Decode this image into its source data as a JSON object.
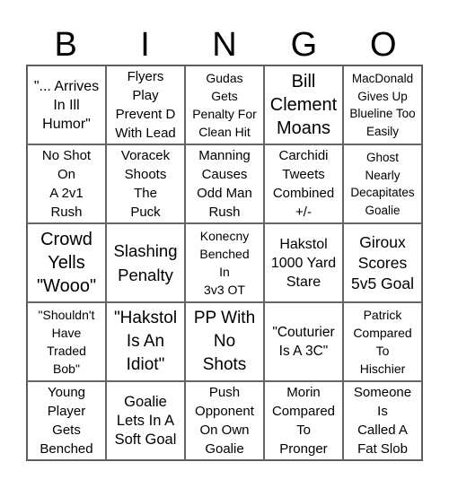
{
  "header": {
    "letters": [
      "B",
      "I",
      "N",
      "G",
      "O"
    ]
  },
  "cells": [
    [
      "\"... Arrives\nIn Ill\nHumor\"",
      "Flyers\nPlay\nPrevent D\nWith Lead",
      "Gudas\nGets\nPenalty For\nClean Hit",
      "Bill\nClement\nMoans",
      "MacDonald\nGives Up\nBlueline Too\nEasily"
    ],
    [
      "No Shot\nOn\nA 2v1\nRush",
      "Voracek\nShoots\nThe\nPuck",
      "Manning\nCauses\nOdd Man\nRush",
      "Carchidi\nTweets\nCombined\n+/-",
      "Ghost\nNearly\nDecapitates\nGoalie"
    ],
    [
      "Crowd\nYells\n\"Wooo\"",
      "Slashing\nPenalty",
      "Konecny\nBenched\nIn\n3v3 OT",
      "Hakstol\n1000 Yard\nStare",
      "Giroux\nScores\n5v5 Goal"
    ],
    [
      "\"Shouldn't\nHave\nTraded\nBob\"",
      "\"Hakstol\nIs An\nIdiot\"",
      "PP With\nNo\nShots",
      "\"Couturier\nIs A 3C\"",
      "Patrick\nCompared\nTo\nHischier"
    ],
    [
      "Young\nPlayer\nGets\nBenched",
      "Goalie\nLets In A\nSoft Goal",
      "Push\nOpponent\nOn Own\nGoalie",
      "Morin\nCompared\nTo\nPronger",
      "Someone\nIs\nCalled A\nFat Slob"
    ]
  ]
}
